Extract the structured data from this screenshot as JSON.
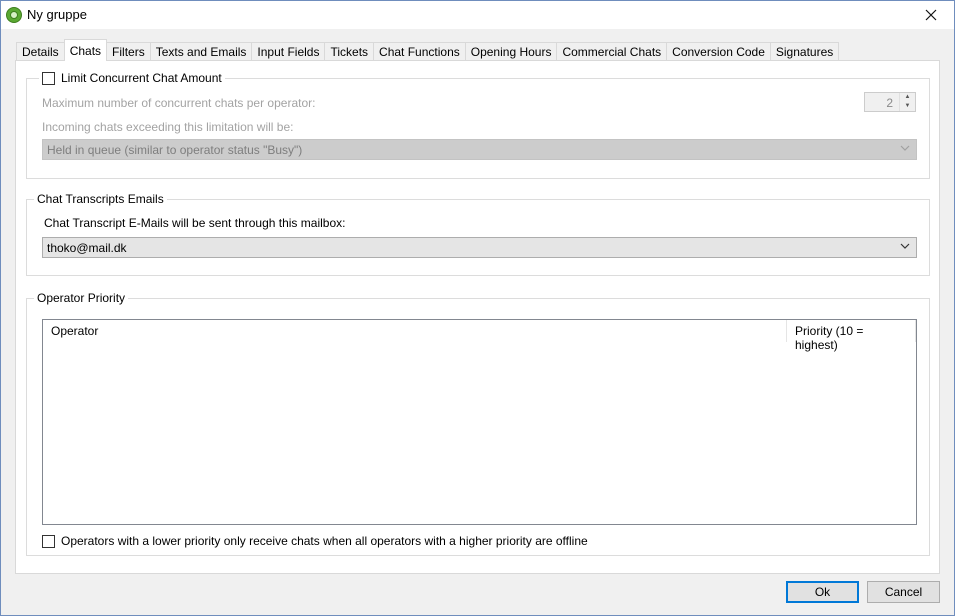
{
  "window": {
    "title": "Ny gruppe"
  },
  "tabs": [
    "Details",
    "Chats",
    "Filters",
    "Texts and Emails",
    "Input Fields",
    "Tickets",
    "Chat Functions",
    "Opening Hours",
    "Commercial Chats",
    "Conversion Code",
    "Signatures"
  ],
  "active_tab": "Chats",
  "concurrent": {
    "checkbox_label": "Limit Concurrent Chat Amount",
    "checked": false,
    "max_label": "Maximum number of concurrent chats per operator:",
    "max_value": "2",
    "exceeding_label": "Incoming chats exceeding this limitation will be:",
    "exceeding_value": "Held in queue (similar to operator status \"Busy\")"
  },
  "transcripts": {
    "group_label": "Chat Transcripts Emails",
    "mailbox_label": "Chat Transcript E-Mails will be sent through this mailbox:",
    "mailbox_value": "thoko@mail.dk"
  },
  "priority": {
    "group_label": "Operator Priority",
    "columns": [
      "Operator",
      "Priority (10 = highest)"
    ],
    "rows": [],
    "offline_checkbox_label": "Operators with a lower priority only receive chats when all operators with a higher priority are offline",
    "offline_checked": false
  },
  "buttons": {
    "ok": "Ok",
    "cancel": "Cancel"
  },
  "icons": {
    "app": "green-gear-icon",
    "close": "close-icon",
    "dropdown": "chevron-down-icon",
    "spin": "spin-arrows-icon"
  },
  "colors": {
    "accent": "#0078d7",
    "app_icon": "#5aa832"
  }
}
